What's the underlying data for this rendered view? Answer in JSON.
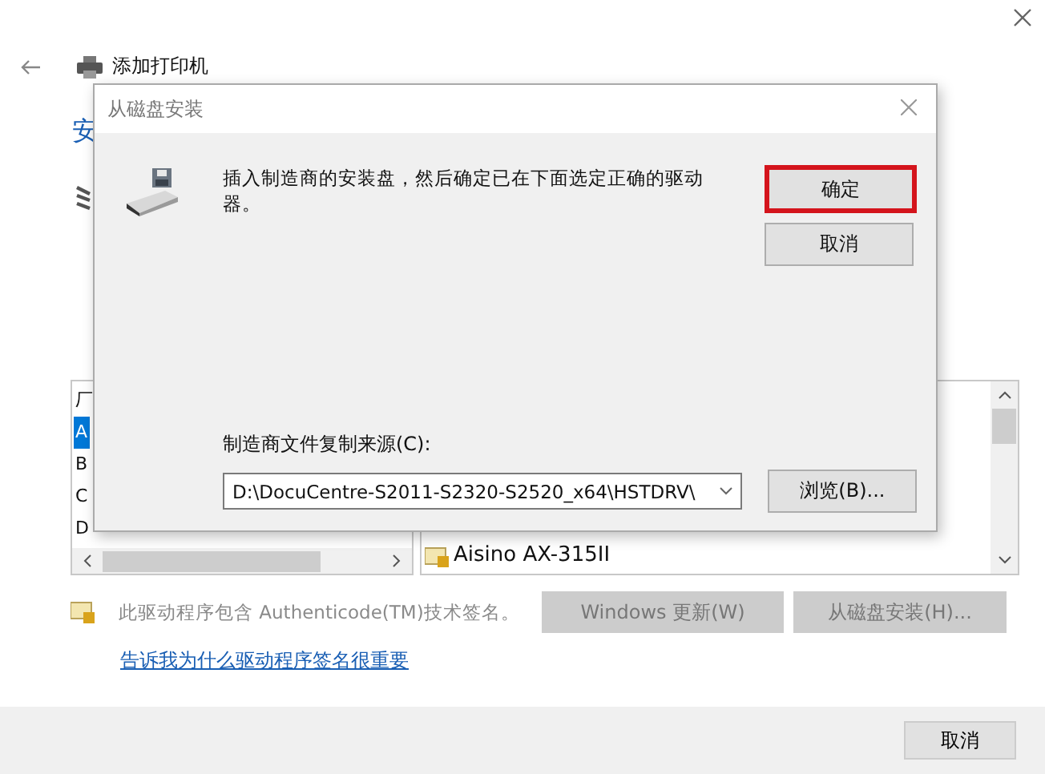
{
  "window": {
    "title": "添加打印机"
  },
  "page": {
    "heading": "安"
  },
  "manufacturers": {
    "items": [
      {
        "label": "厂",
        "selected": false
      },
      {
        "label": "A",
        "selected": true
      },
      {
        "label": "B",
        "selected": false
      },
      {
        "label": "C",
        "selected": false
      },
      {
        "label": "D",
        "selected": false
      }
    ]
  },
  "printers": {
    "items": [
      {
        "label": "Aisino AX-315II"
      }
    ]
  },
  "signature_note": "此驱动程序包含 Authenticode(TM)技术签名。",
  "action_buttons": [
    {
      "label": "Windows 更新(W)",
      "disabled": true
    },
    {
      "label": "从磁盘安装(H)...",
      "disabled": true
    }
  ],
  "help_link": "告诉我为什么驱动程序签名很重要",
  "footer_buttons": [
    {
      "label": "取消"
    }
  ],
  "dialog": {
    "title": "从磁盘安装",
    "message": "插入制造商的安装盘，然后确定已在下面选定正确的驱动器。",
    "buttons": [
      {
        "label": "确定",
        "highlighted": true
      },
      {
        "label": "取消",
        "highlighted": false
      }
    ],
    "source_label": "制造商文件复制来源(C):",
    "source_value": "D:\\DocuCentre-S2011-S2320-S2520_x64\\HSTDRV\\",
    "browse_button": "浏览(B)..."
  }
}
